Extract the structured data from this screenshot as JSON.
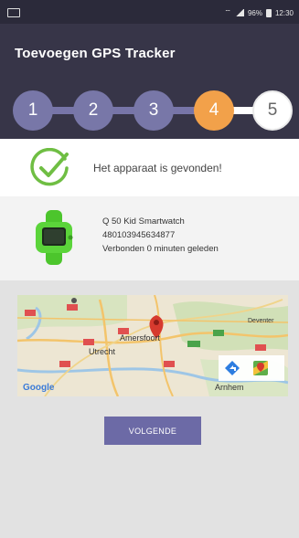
{
  "statusbar": {
    "battery_percent": "96%",
    "time": "12:30"
  },
  "appbar": {
    "title": "Toevoegen GPS Tracker"
  },
  "stepper": {
    "steps": [
      "1",
      "2",
      "3",
      "4",
      "5"
    ],
    "active_step": 4
  },
  "found": {
    "message": "Het apparaat is gevonden!"
  },
  "device": {
    "name": "Q 50 Kid Smartwatch",
    "imei": "480103945634877",
    "connected": "Verbonden 0 minuten geleden"
  },
  "map": {
    "labels": {
      "utrecht": "Utrecht",
      "amersfoort": "Amersfoort",
      "arnhem": "Arnhem",
      "deventer": "Deventer",
      "google": "Google"
    }
  },
  "button": {
    "next_label": "VOLGENDE"
  },
  "colors": {
    "appbar": "#373548",
    "step_done": "#7877a8",
    "step_active": "#f2a14a",
    "button": "#6c6aa6",
    "check": "#6fbe43"
  }
}
